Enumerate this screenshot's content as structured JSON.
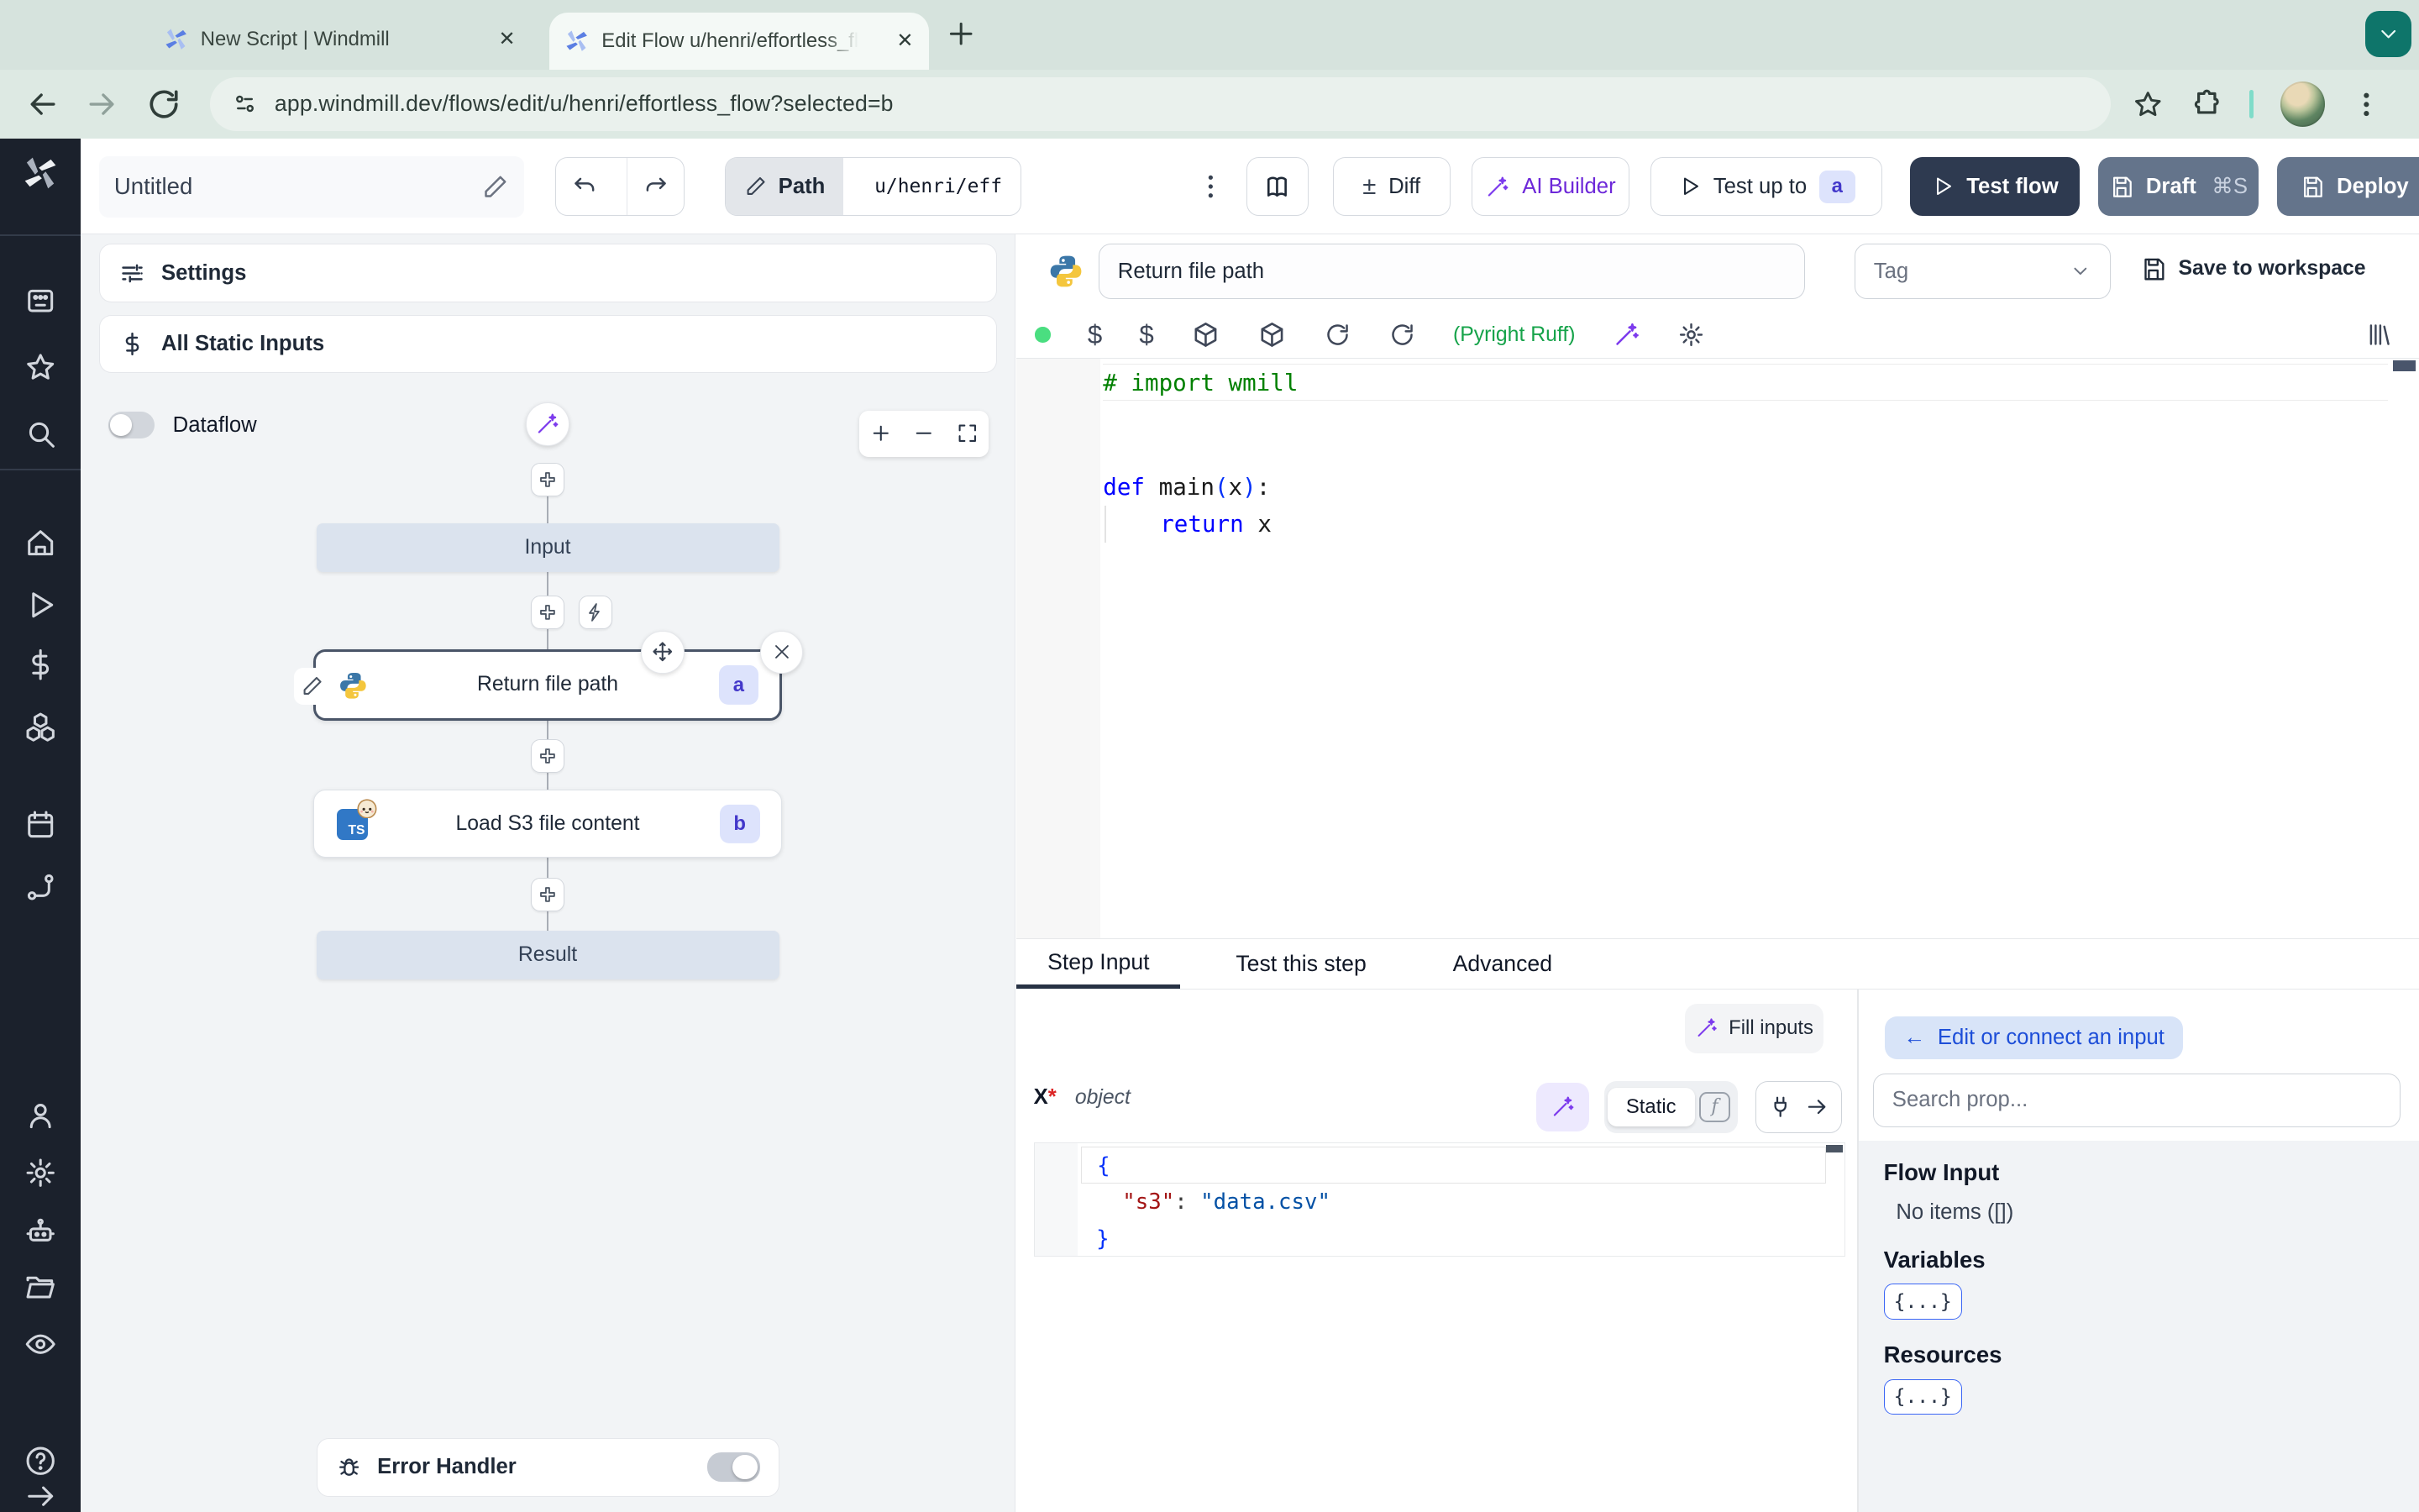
{
  "browser": {
    "tab1_title": "New Script | Windmill",
    "tab2_title": "Edit Flow u/henri/effortless_fl",
    "url": "app.windmill.dev/flows/edit/u/henri/effortless_flow?selected=b"
  },
  "toolbar": {
    "flow_name": "Untitled",
    "path_label": "Path",
    "path_value": "u/henri/eff",
    "plusminus": "±",
    "diff_label": "Diff",
    "ai_builder_label": "AI Builder",
    "test_up_to_label": "Test up to",
    "test_up_to_badge": "a",
    "test_flow_label": "Test flow",
    "draft_label": "Draft",
    "draft_shortcut": "⌘S",
    "deploy_label": "Deploy"
  },
  "flow_panel": {
    "settings_label": "Settings",
    "static_inputs_label": "All Static Inputs",
    "dataflow_label": "Dataflow",
    "input_node": "Input",
    "step_a_label": "Return file path",
    "step_a_badge": "a",
    "step_b_label": "Load S3 file content",
    "step_b_badge": "b",
    "step_b_icon_text": "TS",
    "result_node": "Result",
    "error_handler_label": "Error Handler"
  },
  "editor": {
    "step_name": "Return file path",
    "tag_placeholder": "Tag",
    "save_label": "Save to workspace",
    "lint_label": "(Pyright Ruff)",
    "dollar": "$",
    "code": {
      "comment": "# import wmill",
      "kw_def": "def",
      "fn_name": "main",
      "paren_open": "(",
      "arg": "x",
      "paren_close": ")",
      "colon": ":",
      "kw_return": "return",
      "return_val": "x"
    }
  },
  "step_panel": {
    "tab_step_input": "Step Input",
    "tab_test_step": "Test this step",
    "tab_advanced": "Advanced",
    "fill_inputs_label": "Fill inputs",
    "arg_name": "X",
    "required_mark": "*",
    "arg_type": "object",
    "static_label": "Static",
    "function_glyph": "f",
    "json": {
      "open": "{",
      "key": "\"s3\"",
      "colon": ":",
      "value": "\"data.csv\"",
      "close": "}"
    }
  },
  "connect_panel": {
    "back_arrow": "←",
    "back_label": "Edit or connect an input",
    "search_placeholder": "Search prop...",
    "flow_input_title": "Flow Input",
    "flow_input_empty": "No items ([])",
    "variables_title": "Variables",
    "resources_title": "Resources",
    "object_chip": "{...}"
  },
  "colors": {
    "accent_indigo": "#4338ca",
    "ai_purple": "#7c3aed",
    "lint_green": "#16a34a",
    "test_flow_bg": "#2e3a50",
    "deploy_bg": "#64748b",
    "browser_theme": "#d6e3dd"
  }
}
